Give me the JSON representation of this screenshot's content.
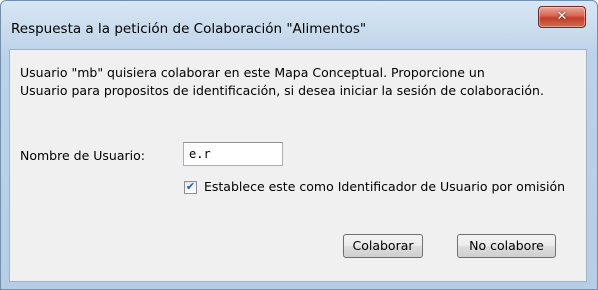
{
  "dialog": {
    "title": "Respuesta a la petición de Colaboración \"Alimentos\"",
    "close_glyph": "✕",
    "message_line1": "Usuario \"mb\" quisiera colaborar en este Mapa Conceptual. Proporcione un",
    "message_line2": "Usuario para propositos de identificación, si desea iniciar la sesión de colaboración.",
    "username_label": "Nombre de Usuario:",
    "username_value": "e.r",
    "default_checkbox": {
      "checked": true,
      "glyph": "✔",
      "label": "Establece este como Identificador de Usuario por omisión"
    },
    "buttons": {
      "collaborate": "Colaborar",
      "decline": "No colabore"
    }
  },
  "icons": {
    "close": "close-icon",
    "check": "check-icon"
  },
  "colors": {
    "frame": "#bcd2ea",
    "close_button": "#c23d28",
    "content_background": "#f0f0f0"
  }
}
